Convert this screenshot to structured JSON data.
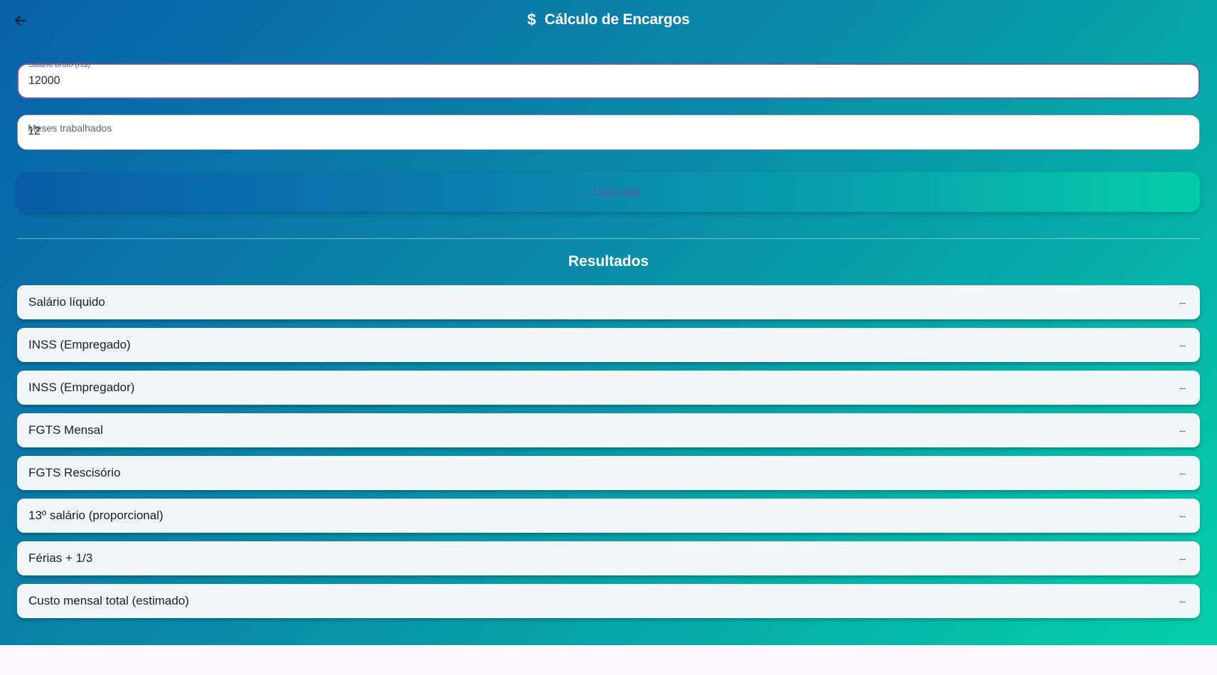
{
  "header": {
    "title": "Cálculo de Encargos",
    "title_icon": "dollar-icon",
    "back_icon": "arrow-left-icon"
  },
  "form": {
    "salary": {
      "label": "Salário bruto (R$)",
      "value": "12000"
    },
    "months": {
      "label": "Meses trabalhados",
      "value": "12"
    },
    "calculate_button": {
      "label": "Calcular",
      "icon": "calculator-icon"
    }
  },
  "results": {
    "title": "Resultados",
    "items": [
      {
        "label": "Salário líquido",
        "value": "--"
      },
      {
        "label": "INSS (Empregado)",
        "value": "--"
      },
      {
        "label": "INSS (Empregador)",
        "value": "--"
      },
      {
        "label": "FGTS Mensal",
        "value": "--"
      },
      {
        "label": "FGTS Rescisório",
        "value": "--"
      },
      {
        "label": "13º salário (proporcional)",
        "value": "--"
      },
      {
        "label": "Férias + 1/3",
        "value": "--"
      },
      {
        "label": "Custo mensal total (estimado)",
        "value": "--"
      }
    ]
  },
  "colors": {
    "gradient_start": "#0860a8",
    "gradient_end": "#05cfa9",
    "button_text": "#7a4aa8",
    "focused_border": "#6d5aa8"
  }
}
